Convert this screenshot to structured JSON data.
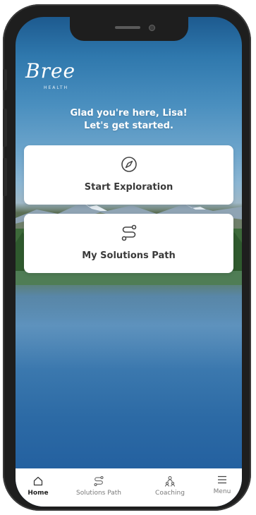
{
  "app": {
    "logo_text": "Bree",
    "logo_subtitle": "HEALTH"
  },
  "greeting": {
    "line1": "Glad you're here, Lisa!",
    "line2": "Let's get started."
  },
  "cards": [
    {
      "label": "Start Exploration",
      "icon": "compass-icon"
    },
    {
      "label": "My Solutions Path",
      "icon": "path-icon"
    }
  ],
  "tabs": [
    {
      "label": "Home",
      "icon": "home-icon",
      "active": true
    },
    {
      "label": "Solutions Path",
      "icon": "path-icon",
      "active": false
    },
    {
      "label": "Coaching",
      "icon": "people-icon",
      "active": false
    },
    {
      "label": "Menu",
      "icon": "menu-icon",
      "active": false
    }
  ],
  "colors": {
    "card_bg": "#ffffff",
    "text_dark": "#3a3a3a",
    "tab_inactive": "#7a7a7a",
    "tab_active": "#1f1f1f"
  }
}
